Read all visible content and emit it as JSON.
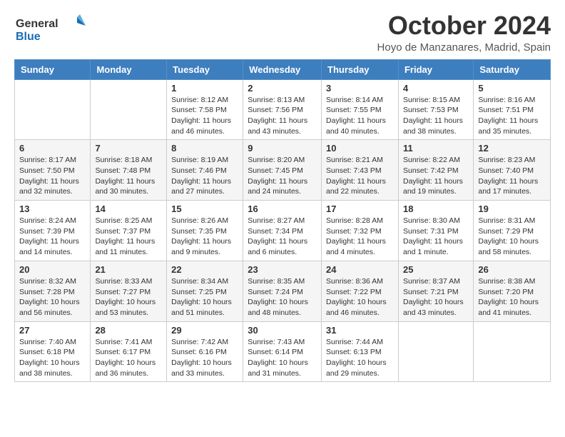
{
  "header": {
    "logo_line1": "General",
    "logo_line2": "Blue",
    "month_title": "October 2024",
    "location": "Hoyo de Manzanares, Madrid, Spain"
  },
  "days_of_week": [
    "Sunday",
    "Monday",
    "Tuesday",
    "Wednesday",
    "Thursday",
    "Friday",
    "Saturday"
  ],
  "weeks": [
    [
      {
        "day": "",
        "info": ""
      },
      {
        "day": "",
        "info": ""
      },
      {
        "day": "1",
        "info": "Sunrise: 8:12 AM\nSunset: 7:58 PM\nDaylight: 11 hours and 46 minutes."
      },
      {
        "day": "2",
        "info": "Sunrise: 8:13 AM\nSunset: 7:56 PM\nDaylight: 11 hours and 43 minutes."
      },
      {
        "day": "3",
        "info": "Sunrise: 8:14 AM\nSunset: 7:55 PM\nDaylight: 11 hours and 40 minutes."
      },
      {
        "day": "4",
        "info": "Sunrise: 8:15 AM\nSunset: 7:53 PM\nDaylight: 11 hours and 38 minutes."
      },
      {
        "day": "5",
        "info": "Sunrise: 8:16 AM\nSunset: 7:51 PM\nDaylight: 11 hours and 35 minutes."
      }
    ],
    [
      {
        "day": "6",
        "info": "Sunrise: 8:17 AM\nSunset: 7:50 PM\nDaylight: 11 hours and 32 minutes."
      },
      {
        "day": "7",
        "info": "Sunrise: 8:18 AM\nSunset: 7:48 PM\nDaylight: 11 hours and 30 minutes."
      },
      {
        "day": "8",
        "info": "Sunrise: 8:19 AM\nSunset: 7:46 PM\nDaylight: 11 hours and 27 minutes."
      },
      {
        "day": "9",
        "info": "Sunrise: 8:20 AM\nSunset: 7:45 PM\nDaylight: 11 hours and 24 minutes."
      },
      {
        "day": "10",
        "info": "Sunrise: 8:21 AM\nSunset: 7:43 PM\nDaylight: 11 hours and 22 minutes."
      },
      {
        "day": "11",
        "info": "Sunrise: 8:22 AM\nSunset: 7:42 PM\nDaylight: 11 hours and 19 minutes."
      },
      {
        "day": "12",
        "info": "Sunrise: 8:23 AM\nSunset: 7:40 PM\nDaylight: 11 hours and 17 minutes."
      }
    ],
    [
      {
        "day": "13",
        "info": "Sunrise: 8:24 AM\nSunset: 7:39 PM\nDaylight: 11 hours and 14 minutes."
      },
      {
        "day": "14",
        "info": "Sunrise: 8:25 AM\nSunset: 7:37 PM\nDaylight: 11 hours and 11 minutes."
      },
      {
        "day": "15",
        "info": "Sunrise: 8:26 AM\nSunset: 7:35 PM\nDaylight: 11 hours and 9 minutes."
      },
      {
        "day": "16",
        "info": "Sunrise: 8:27 AM\nSunset: 7:34 PM\nDaylight: 11 hours and 6 minutes."
      },
      {
        "day": "17",
        "info": "Sunrise: 8:28 AM\nSunset: 7:32 PM\nDaylight: 11 hours and 4 minutes."
      },
      {
        "day": "18",
        "info": "Sunrise: 8:30 AM\nSunset: 7:31 PM\nDaylight: 11 hours and 1 minute."
      },
      {
        "day": "19",
        "info": "Sunrise: 8:31 AM\nSunset: 7:29 PM\nDaylight: 10 hours and 58 minutes."
      }
    ],
    [
      {
        "day": "20",
        "info": "Sunrise: 8:32 AM\nSunset: 7:28 PM\nDaylight: 10 hours and 56 minutes."
      },
      {
        "day": "21",
        "info": "Sunrise: 8:33 AM\nSunset: 7:27 PM\nDaylight: 10 hours and 53 minutes."
      },
      {
        "day": "22",
        "info": "Sunrise: 8:34 AM\nSunset: 7:25 PM\nDaylight: 10 hours and 51 minutes."
      },
      {
        "day": "23",
        "info": "Sunrise: 8:35 AM\nSunset: 7:24 PM\nDaylight: 10 hours and 48 minutes."
      },
      {
        "day": "24",
        "info": "Sunrise: 8:36 AM\nSunset: 7:22 PM\nDaylight: 10 hours and 46 minutes."
      },
      {
        "day": "25",
        "info": "Sunrise: 8:37 AM\nSunset: 7:21 PM\nDaylight: 10 hours and 43 minutes."
      },
      {
        "day": "26",
        "info": "Sunrise: 8:38 AM\nSunset: 7:20 PM\nDaylight: 10 hours and 41 minutes."
      }
    ],
    [
      {
        "day": "27",
        "info": "Sunrise: 7:40 AM\nSunset: 6:18 PM\nDaylight: 10 hours and 38 minutes."
      },
      {
        "day": "28",
        "info": "Sunrise: 7:41 AM\nSunset: 6:17 PM\nDaylight: 10 hours and 36 minutes."
      },
      {
        "day": "29",
        "info": "Sunrise: 7:42 AM\nSunset: 6:16 PM\nDaylight: 10 hours and 33 minutes."
      },
      {
        "day": "30",
        "info": "Sunrise: 7:43 AM\nSunset: 6:14 PM\nDaylight: 10 hours and 31 minutes."
      },
      {
        "day": "31",
        "info": "Sunrise: 7:44 AM\nSunset: 6:13 PM\nDaylight: 10 hours and 29 minutes."
      },
      {
        "day": "",
        "info": ""
      },
      {
        "day": "",
        "info": ""
      }
    ]
  ]
}
